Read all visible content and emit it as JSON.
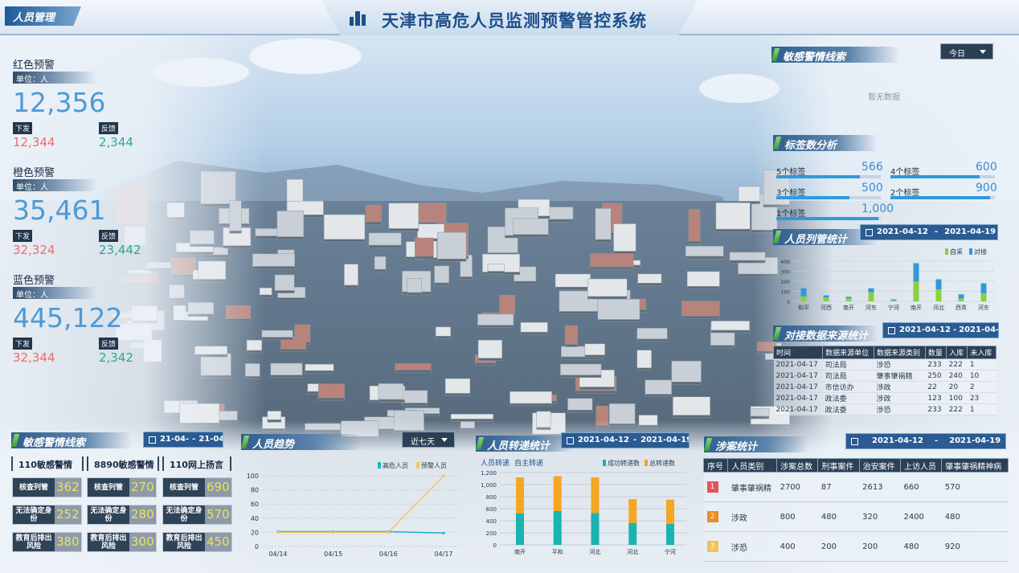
{
  "header": {
    "title": "天津市高危人员监测预警管控系统",
    "tab": "人员管理"
  },
  "warnings": [
    {
      "label": "红色预警",
      "unit": "单位：人",
      "total": "12,356",
      "down_label": "下发",
      "down": "12,344",
      "fb_label": "反馈",
      "fb": "2,344"
    },
    {
      "label": "橙色预警",
      "unit": "单位：人",
      "total": "35,461",
      "down_label": "下发",
      "down": "32,324",
      "fb_label": "反馈",
      "fb": "23,442"
    },
    {
      "label": "蓝色预警",
      "unit": "单位：人",
      "total": "445,122",
      "down_label": "下发",
      "down": "32,344",
      "fb_label": "反馈",
      "fb": "2,342"
    }
  ],
  "sensitive_left": {
    "title": "敏感警情线索",
    "date_from": "21-04-",
    "date_sep": "-",
    "date_to": "21-04-",
    "tabs": [
      "110敏感警情",
      "8890敏感警情",
      "110网上扬言"
    ],
    "cells": [
      {
        "label": "核查列管",
        "value": "362"
      },
      {
        "label": "核查列管",
        "value": "270"
      },
      {
        "label": "核查列管",
        "value": "690"
      },
      {
        "label": "无法确定身份",
        "value": "252"
      },
      {
        "label": "无法确定身份",
        "value": "280"
      },
      {
        "label": "无法确定身份",
        "value": "570"
      },
      {
        "label": "教育后排出风险",
        "value": "380"
      },
      {
        "label": "教育后排出风险",
        "value": "300"
      },
      {
        "label": "教育后排出风险",
        "value": "450"
      }
    ]
  },
  "trend": {
    "title": "人员趋势",
    "range": "近七天",
    "chart_data": {
      "type": "line",
      "categories": [
        "04/14",
        "04/15",
        "04/16",
        "04/17"
      ],
      "series": [
        {
          "name": "高危人员",
          "color": "#12b5cf",
          "values": [
            21,
            21,
            21,
            19
          ]
        },
        {
          "name": "预警人员",
          "color": "#f0c85a",
          "values": [
            20,
            20,
            20,
            100
          ]
        }
      ],
      "ylim": [
        0,
        100
      ],
      "yticks": [
        0,
        20,
        40,
        60,
        80,
        100
      ]
    }
  },
  "transfer": {
    "title": "人员转递统计",
    "date_from": "2021-04-12",
    "date_sep": "-",
    "date_to": "2021-04-19",
    "tab1": "人员转递",
    "tab2": "自主转递",
    "chart_data": {
      "type": "bar",
      "categories": [
        "南开",
        "平和",
        "河北",
        "河北",
        "宁河"
      ],
      "series": [
        {
          "name": "成功转递数",
          "color": "#1ab3b0",
          "values": [
            520,
            560,
            530,
            360,
            350
          ]
        },
        {
          "name": "总转递数",
          "color": "#f5a623",
          "values": [
            600,
            580,
            590,
            400,
            400
          ]
        }
      ],
      "ylim": [
        0,
        1200
      ],
      "yticks": [
        0,
        200,
        400,
        600,
        800,
        1000,
        1200
      ]
    }
  },
  "sensitive_right": {
    "title": "敏感警情线索",
    "range": "今日",
    "empty": "暂无数据"
  },
  "tags": {
    "title": "标签数分析",
    "items": [
      {
        "label": "5个标签",
        "value": "566",
        "pct": 0.8
      },
      {
        "label": "4个标签",
        "value": "600",
        "pct": 0.85
      },
      {
        "label": "3个标签",
        "value": "500",
        "pct": 0.7
      },
      {
        "label": "2个标签",
        "value": "900",
        "pct": 0.95
      },
      {
        "label": "1个标签",
        "value": "1,000",
        "pct": 0.98
      }
    ]
  },
  "control": {
    "title": "人员列管统计",
    "date_from": "2021-04-12",
    "date_sep": "-",
    "date_to": "2021-04-19",
    "chart_data": {
      "type": "bar",
      "categories": [
        "和平",
        "河西",
        "南开",
        "河东",
        "宁河",
        "南开",
        "河北",
        "西青",
        "河东"
      ],
      "series": [
        {
          "name": "自采",
          "color": "#8bd13c",
          "values": [
            50,
            40,
            30,
            90,
            10,
            200,
            120,
            30,
            80
          ]
        },
        {
          "name": "对接",
          "color": "#2f9ad9",
          "values": [
            80,
            20,
            15,
            40,
            10,
            180,
            100,
            40,
            100
          ]
        }
      ],
      "ylim": [
        0,
        400
      ],
      "yticks": [
        0,
        100,
        200,
        300,
        400
      ]
    }
  },
  "source": {
    "title": "对接数据来源统计",
    "date_from": "2021-04-12",
    "date_sep": "-",
    "date_to": "2021-04-19",
    "headers": [
      "时间",
      "数据来源单位",
      "数据来源类别",
      "数量",
      "入库",
      "未入库"
    ],
    "rows": [
      [
        "2021-04-17",
        "司法局",
        "涉恐",
        "233",
        "222",
        "1"
      ],
      [
        "2021-04-17",
        "司法局",
        "肇事肇祸精",
        "250",
        "240",
        "10"
      ],
      [
        "2021-04-17",
        "市信访办",
        "涉政",
        "22",
        "20",
        "2"
      ],
      [
        "2021-04-17",
        "政法委",
        "涉政",
        "123",
        "100",
        "23"
      ],
      [
        "2021-04-17",
        "政法委",
        "涉恐",
        "233",
        "222",
        "1"
      ]
    ]
  },
  "cases": {
    "title": "涉案统计",
    "date_from": "2021-04-12",
    "date_sep": "-",
    "date_to": "2021-04-19",
    "headers": [
      "序号",
      "人员类别",
      "涉案总数",
      "刑事案件",
      "治安案件",
      "上访人员",
      "肇事肇祸精神病"
    ],
    "rows": [
      {
        "rank": "1",
        "color": "#e4555b",
        "cat": "肇事肇祸精",
        "total": "2700",
        "criminal": "87",
        "security": "2613",
        "petition": "660",
        "mental": "570"
      },
      {
        "rank": "2",
        "color": "#f08a24",
        "cat": "涉政",
        "total": "800",
        "criminal": "480",
        "security": "320",
        "petition": "2400",
        "mental": "480"
      },
      {
        "rank": "3",
        "color": "#f3c05d",
        "cat": "涉恐",
        "total": "400",
        "criminal": "200",
        "security": "200",
        "petition": "480",
        "mental": "920"
      }
    ]
  }
}
